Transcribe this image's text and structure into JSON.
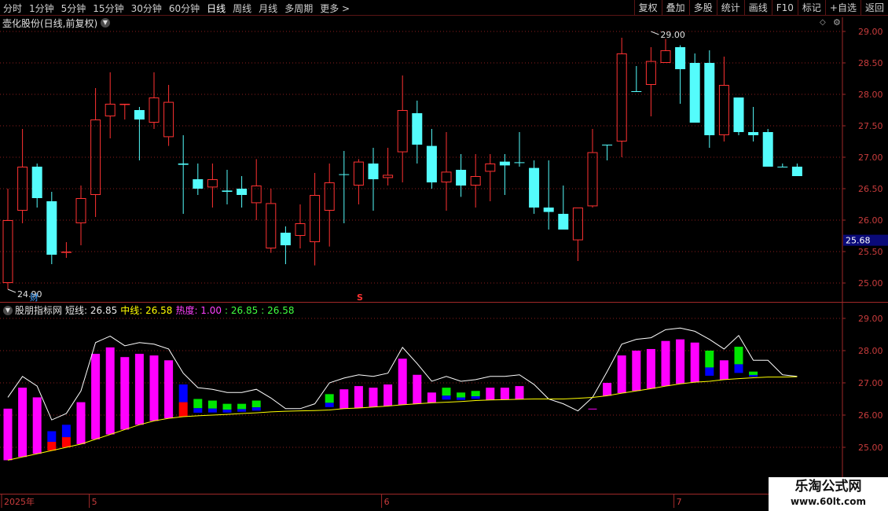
{
  "toolbar": {
    "periods": [
      "分时",
      "1分钟",
      "5分钟",
      "15分钟",
      "30分钟",
      "60分钟",
      "日线",
      "周线",
      "月线",
      "多周期",
      "更多 >"
    ],
    "active_period": "日线",
    "right_buttons": [
      "复权",
      "叠加",
      "多股",
      "统计",
      "画线",
      "F10",
      "标记",
      "+自选",
      "返回"
    ]
  },
  "stock": {
    "title": "壶化股份(日线,前复权)"
  },
  "indicator": {
    "name": "股朋指标网",
    "short_label": "短线: 26.85",
    "mid_label": "中线: 26.58",
    "heat_label": "热度: 1.00",
    "v1_label": ": 26.85",
    "v2_label": ": 26.58"
  },
  "price_axis": {
    "ticks": [
      "29.00",
      "28.50",
      "28.00",
      "27.50",
      "27.00",
      "26.50",
      "26.00",
      "25.50",
      "25.00"
    ],
    "current_price": "25.68"
  },
  "indicator_axis": {
    "ticks": [
      "29.00",
      "28.00",
      "27.00",
      "26.00",
      "25.00"
    ]
  },
  "annotations": {
    "high": "29.00",
    "low": "24.90",
    "cai_marker": "财",
    "s_marker": "S"
  },
  "date_axis": {
    "labels": [
      {
        "index": 0,
        "text": "2025年"
      },
      {
        "index": 6,
        "text": "5"
      },
      {
        "index": 26,
        "text": "6"
      },
      {
        "index": 46,
        "text": "7"
      }
    ]
  },
  "colors": {
    "up": "#ff3232",
    "down": "#54fcfc",
    "magenta": "#ff00ff",
    "green_bar": "#00e600",
    "blue_bar": "#0000ff",
    "red_bar": "#ff0000",
    "white_line": "#ffffff",
    "yellow_line": "#ffff00",
    "grid": "#8c1e1e",
    "frame": "#a02828"
  },
  "chart_data": [
    {
      "type": "candlestick",
      "ylim": [
        24.7,
        29.2
      ],
      "x_index": [
        0,
        1,
        2,
        3,
        4,
        5,
        6,
        7,
        8,
        9,
        10,
        11,
        12,
        13,
        14,
        15,
        16,
        17,
        18,
        19,
        20,
        21,
        22,
        23,
        24,
        25,
        26,
        27,
        28,
        29,
        30,
        31,
        32,
        33,
        34,
        35,
        36,
        37,
        38,
        39,
        40,
        41,
        42,
        43,
        44,
        45,
        46,
        47,
        48,
        49,
        50,
        51,
        52,
        53,
        54
      ],
      "open": [
        25.0,
        26.15,
        26.85,
        26.3,
        25.48,
        25.95,
        26.4,
        27.65,
        27.85,
        27.75,
        27.55,
        27.32,
        26.9,
        26.65,
        26.52,
        26.47,
        26.5,
        26.27,
        25.55,
        25.8,
        25.75,
        25.65,
        26.15,
        26.73,
        26.55,
        26.9,
        26.67,
        27.08,
        27.7,
        27.18,
        26.6,
        26.8,
        26.55,
        26.77,
        26.93,
        26.92,
        26.83,
        26.2,
        26.1,
        25.68,
        26.22,
        27.2,
        27.25,
        28.05,
        28.15,
        28.5,
        28.75,
        28.5,
        28.5,
        27.35,
        27.95,
        27.4,
        27.4,
        26.85,
        26.85
      ],
      "close": [
        26.0,
        26.85,
        26.35,
        25.45,
        25.5,
        26.35,
        27.6,
        27.85,
        27.85,
        27.6,
        27.95,
        27.88,
        26.88,
        26.5,
        26.65,
        26.45,
        26.4,
        26.55,
        26.27,
        25.6,
        25.95,
        26.4,
        26.6,
        26.73,
        26.93,
        26.65,
        26.72,
        27.75,
        27.2,
        26.6,
        26.77,
        26.55,
        26.7,
        26.9,
        26.87,
        26.92,
        26.2,
        26.13,
        25.85,
        26.2,
        27.08,
        27.2,
        28.65,
        28.05,
        28.53,
        28.7,
        28.4,
        27.55,
        27.35,
        28.15,
        27.4,
        27.35,
        26.85,
        26.85,
        26.7
      ],
      "high": [
        26.5,
        27.45,
        26.9,
        26.45,
        25.65,
        26.55,
        28.1,
        28.35,
        27.85,
        27.8,
        28.35,
        28.15,
        27.35,
        26.9,
        26.9,
        26.8,
        26.7,
        26.97,
        26.5,
        25.9,
        26.25,
        26.75,
        26.9,
        27.1,
        26.97,
        27.15,
        27.15,
        28.3,
        27.9,
        27.45,
        27.4,
        27.05,
        27.05,
        27.05,
        27.05,
        27.4,
        26.95,
        26.95,
        26.55,
        26.2,
        27.45,
        27.2,
        28.9,
        28.45,
        28.75,
        28.88,
        28.78,
        28.65,
        28.7,
        28.6,
        27.95,
        27.8,
        27.45,
        26.9,
        26.9
      ],
      "low": [
        24.9,
        25.95,
        26.2,
        25.3,
        25.4,
        25.6,
        26.05,
        27.3,
        27.6,
        26.95,
        27.45,
        27.18,
        26.1,
        26.4,
        26.2,
        26.25,
        26.2,
        26.0,
        25.48,
        25.3,
        25.55,
        25.28,
        25.58,
        25.95,
        26.25,
        26.15,
        26.55,
        26.6,
        26.9,
        26.5,
        26.15,
        26.37,
        26.2,
        26.3,
        26.4,
        26.85,
        26.1,
        25.85,
        25.85,
        25.35,
        26.2,
        26.95,
        27.0,
        28.05,
        27.65,
        28.5,
        27.85,
        27.9,
        27.15,
        27.25,
        27.35,
        27.25,
        27.05,
        26.85,
        26.85
      ],
      "annotations": [
        {
          "text": "29.00",
          "index": 44,
          "value": 29.0
        },
        {
          "text": "24.90",
          "index": 0,
          "value": 24.9
        }
      ]
    },
    {
      "type": "bar",
      "title": "股朋指标网",
      "ylim": [
        24.1,
        29.6
      ],
      "x_index": [
        0,
        1,
        2,
        3,
        4,
        5,
        6,
        7,
        8,
        9,
        10,
        11,
        12,
        13,
        14,
        15,
        16,
        17,
        18,
        19,
        20,
        21,
        22,
        23,
        24,
        25,
        26,
        27,
        28,
        29,
        30,
        31,
        32,
        33,
        34,
        35,
        36,
        37,
        38,
        39,
        40,
        41,
        42,
        43,
        44,
        45,
        46,
        47,
        48,
        49,
        50,
        51,
        52,
        53,
        54
      ],
      "series": [
        {
          "name": "短线",
          "values": [
            26.2,
            26.85,
            26.55,
            25.5,
            25.7,
            26.4,
            27.9,
            28.1,
            27.8,
            27.9,
            27.85,
            27.7,
            26.95,
            26.5,
            26.45,
            26.35,
            26.35,
            26.45,
            26.18,
            25.85,
            25.85,
            26.0,
            26.65,
            26.8,
            26.9,
            26.85,
            26.95,
            27.75,
            27.25,
            26.7,
            26.85,
            26.7,
            26.75,
            26.85,
            26.85,
            26.9,
            26.6,
            26.15,
            26.0,
            25.78,
            26.2,
            27.0,
            27.85,
            28.0,
            28.05,
            28.3,
            28.35,
            28.25,
            28.0,
            27.7,
            28.12,
            27.35,
            27.35,
            26.9,
            26.85
          ]
        },
        {
          "name": "中线",
          "values": [
            24.6,
            24.7,
            24.8,
            24.9,
            25.0,
            25.1,
            25.25,
            25.4,
            25.55,
            25.7,
            25.82,
            25.9,
            25.95,
            25.98,
            26.0,
            26.02,
            26.05,
            26.07,
            26.1,
            26.12,
            26.13,
            26.14,
            26.16,
            26.2,
            26.22,
            26.25,
            26.28,
            26.32,
            26.35,
            26.38,
            26.4,
            26.42,
            26.45,
            26.47,
            26.48,
            26.49,
            26.5,
            26.5,
            26.5,
            26.52,
            26.55,
            26.6,
            26.68,
            26.75,
            26.82,
            26.9,
            26.97,
            27.02,
            27.05,
            27.1,
            27.13,
            27.16,
            27.18,
            27.18,
            27.19
          ]
        }
      ]
    }
  ]
}
